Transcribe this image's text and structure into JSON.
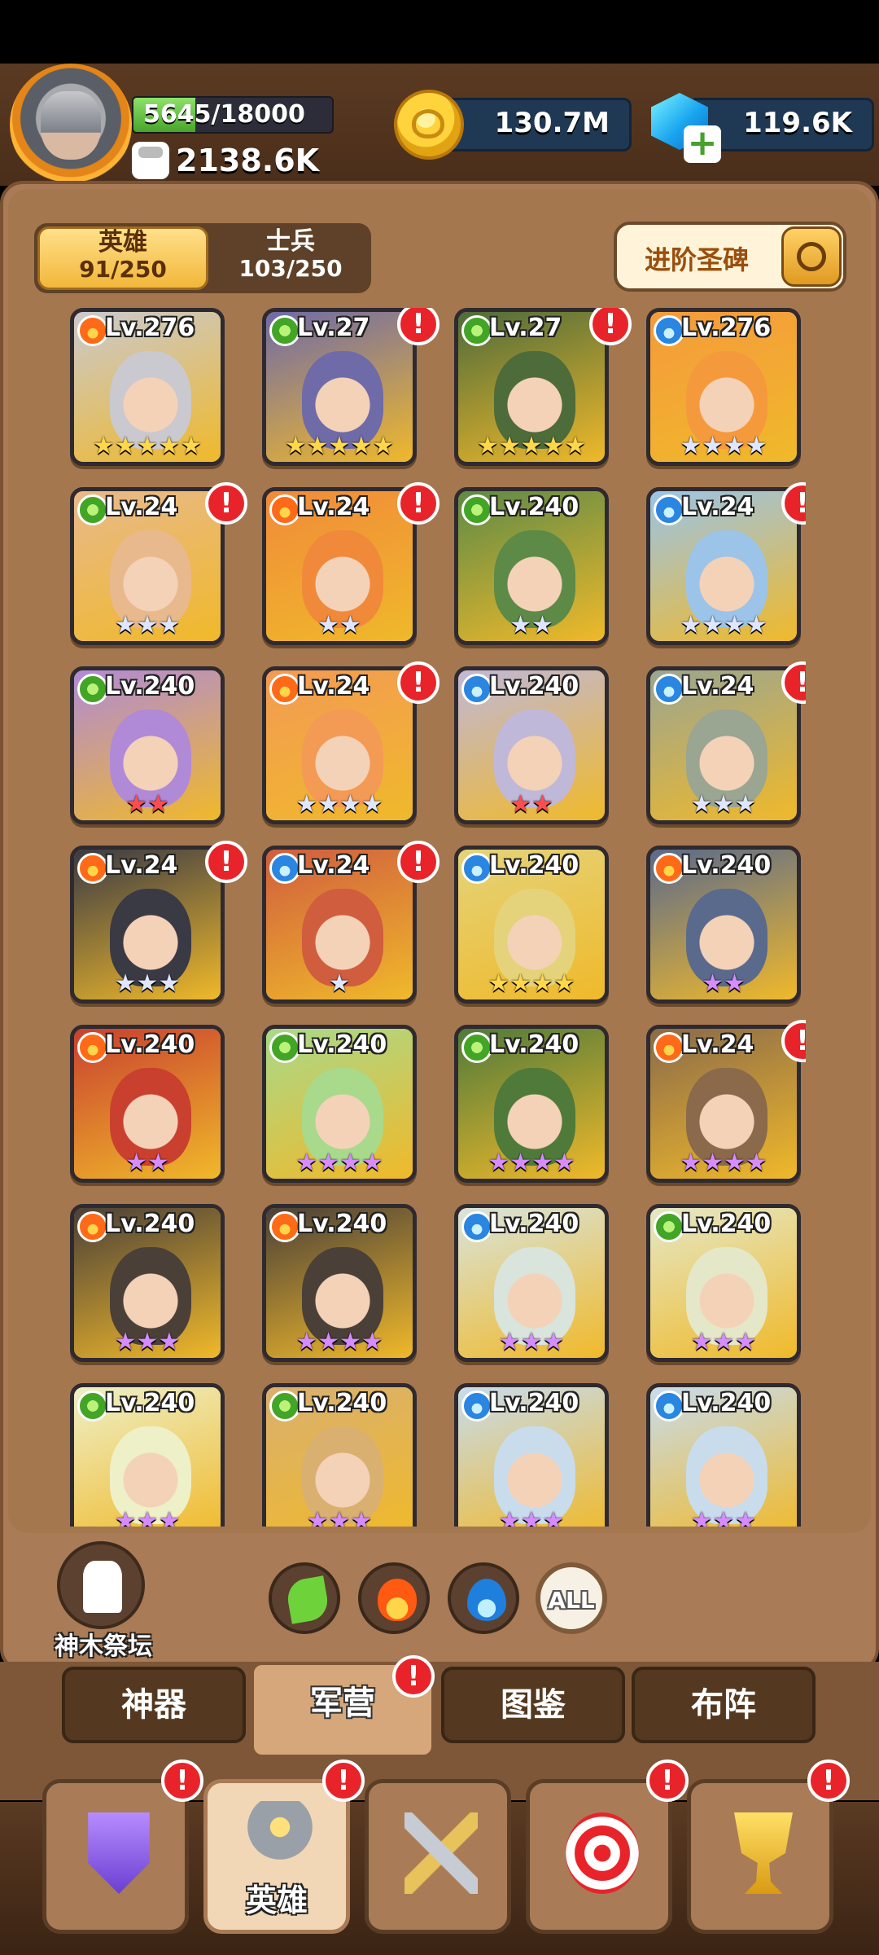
{
  "header": {
    "xp_text": "5645/18000",
    "xp_fraction": 0.31,
    "power": "2138.6K",
    "coins": "130.7M",
    "gems": "119.6K"
  },
  "tabs": [
    {
      "label": "英雄",
      "count": "91/250",
      "active": true
    },
    {
      "label": "士兵",
      "count": "103/250",
      "active": false
    }
  ],
  "stele_button": "进阶圣碑",
  "heroes": [
    {
      "level": "Lv.276",
      "element": "fire",
      "stars": "★★★★★",
      "star_color": "gold",
      "alert": false,
      "bg": "#c9c9cf"
    },
    {
      "level": "Lv.27",
      "element": "leaf",
      "stars": "★★★★★",
      "star_color": "gold",
      "alert": true,
      "bg": "#6f6aa8"
    },
    {
      "level": "Lv.27",
      "element": "leaf",
      "stars": "★★★★★",
      "star_color": "gold",
      "alert": true,
      "bg": "#4e6b3a"
    },
    {
      "level": "Lv.276",
      "element": "water",
      "stars": "★★★★",
      "star_color": "blue",
      "alert": false,
      "bg": "#f59a3c"
    },
    {
      "level": "Lv.24",
      "element": "leaf",
      "stars": "★★★",
      "star_color": "blue",
      "alert": true,
      "bg": "#e8b98c"
    },
    {
      "level": "Lv.24",
      "element": "fire",
      "stars": "★★",
      "star_color": "blue",
      "alert": true,
      "bg": "#f08a3a"
    },
    {
      "level": "Lv.240",
      "element": "leaf",
      "stars": "★★",
      "star_color": "blue",
      "alert": false,
      "bg": "#5d8a46"
    },
    {
      "level": "Lv.24",
      "element": "water",
      "stars": "★★★★",
      "star_color": "blue",
      "alert": true,
      "bg": "#9bc4e8"
    },
    {
      "level": "Lv.240",
      "element": "leaf",
      "stars": "★★",
      "star_color": "red",
      "alert": false,
      "bg": "#b08ad6"
    },
    {
      "level": "Lv.24",
      "element": "fire",
      "stars": "★★★★",
      "star_color": "blue",
      "alert": true,
      "bg": "#f39a55"
    },
    {
      "level": "Lv.240",
      "element": "water",
      "stars": "★★",
      "star_color": "red",
      "alert": false,
      "bg": "#c0b8d8"
    },
    {
      "level": "Lv.24",
      "element": "water",
      "stars": "★★★",
      "star_color": "blue",
      "alert": true,
      "bg": "#9aa592"
    },
    {
      "level": "Lv.24",
      "element": "fire",
      "stars": "★★★",
      "star_color": "blue",
      "alert": true,
      "bg": "#3a3a44"
    },
    {
      "level": "Lv.24",
      "element": "water",
      "stars": "★",
      "star_color": "blue",
      "alert": true,
      "bg": "#d05d3e"
    },
    {
      "level": "Lv.240",
      "element": "water",
      "stars": "★★★★",
      "star_color": "gold",
      "alert": false,
      "bg": "#e4d37a"
    },
    {
      "level": "Lv.240",
      "element": "fire",
      "stars": "★★",
      "star_color": "purple",
      "alert": false,
      "bg": "#5a6a8c"
    },
    {
      "level": "Lv.240",
      "element": "fire",
      "stars": "★★",
      "star_color": "purple",
      "alert": false,
      "bg": "#c9402f"
    },
    {
      "level": "Lv.240",
      "element": "leaf",
      "stars": "★★★★",
      "star_color": "purple",
      "alert": false,
      "bg": "#a9d98a"
    },
    {
      "level": "Lv.240",
      "element": "leaf",
      "stars": "★★★★",
      "star_color": "purple",
      "alert": false,
      "bg": "#4f7a3a"
    },
    {
      "level": "Lv.24",
      "element": "fire",
      "stars": "★★★★",
      "star_color": "purple",
      "alert": true,
      "bg": "#8a6a4a"
    },
    {
      "level": "Lv.240",
      "element": "fire",
      "stars": "★★★",
      "star_color": "purple",
      "alert": false,
      "bg": "#4a4038"
    },
    {
      "level": "Lv.240",
      "element": "fire",
      "stars": "★★★★",
      "star_color": "purple",
      "alert": false,
      "bg": "#4a4038"
    },
    {
      "level": "Lv.240",
      "element": "water",
      "stars": "★★★",
      "star_color": "purple",
      "alert": false,
      "bg": "#d8e4dc"
    },
    {
      "level": "Lv.240",
      "element": "leaf",
      "stars": "★★★",
      "star_color": "purple",
      "alert": false,
      "bg": "#e4e8c8"
    },
    {
      "level": "Lv.240",
      "element": "leaf",
      "stars": "★★★",
      "star_color": "purple",
      "alert": false,
      "bg": "#eef0c8"
    },
    {
      "level": "Lv.240",
      "element": "leaf",
      "stars": "★★★",
      "star_color": "purple",
      "alert": false,
      "bg": "#d9b070"
    },
    {
      "level": "Lv.240",
      "element": "water",
      "stars": "★★★",
      "star_color": "purple",
      "alert": false,
      "bg": "#c8dcec"
    },
    {
      "level": "Lv.240",
      "element": "water",
      "stars": "★★★",
      "star_color": "purple",
      "alert": false,
      "bg": "#c8dcec"
    }
  ],
  "filters": {
    "altar_label": "神木祭坛",
    "all_label": "ALL"
  },
  "section_tabs": [
    {
      "label": "神器",
      "active": false,
      "alert": false
    },
    {
      "label": "军营",
      "active": true,
      "alert": true
    },
    {
      "label": "图鉴",
      "active": false,
      "alert": false
    },
    {
      "label": "布阵",
      "active": false,
      "alert": false
    }
  ],
  "bottom_nav": [
    {
      "icon": "shield-sword-icon",
      "label": "",
      "active": false,
      "alert": true
    },
    {
      "icon": "viking-helmet-icon",
      "label": "英雄",
      "active": true,
      "alert": true
    },
    {
      "icon": "crossed-swords-icon",
      "label": "",
      "active": false,
      "alert": false
    },
    {
      "icon": "target-icon",
      "label": "",
      "active": false,
      "alert": true
    },
    {
      "icon": "trophy-icon",
      "label": "",
      "active": false,
      "alert": true
    }
  ],
  "colors": {
    "panel": "#a97b56",
    "alert": "#e8242a",
    "accent_gold": "#f2b73a"
  }
}
